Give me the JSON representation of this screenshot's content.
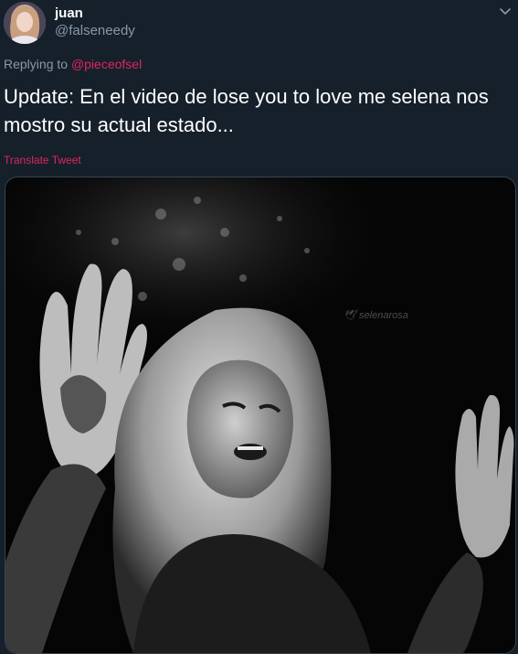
{
  "tweet": {
    "author": {
      "display_name": "juan",
      "handle": "@falseneedy"
    },
    "reply_prefix": "Replying to ",
    "reply_to": "@pieceofsel",
    "text": "Update: En el video de lose you to love me selena nos mostro su actual estado...",
    "translate_label": "Translate Tweet",
    "media": {
      "watermark": "selenarosa"
    }
  },
  "colors": {
    "background": "#15202b",
    "accent": "#e0245e",
    "secondary_text": "#8899a6",
    "border": "#38444d"
  },
  "icons": {
    "menu": "chevron-down-icon",
    "watermark": "bird-icon"
  }
}
